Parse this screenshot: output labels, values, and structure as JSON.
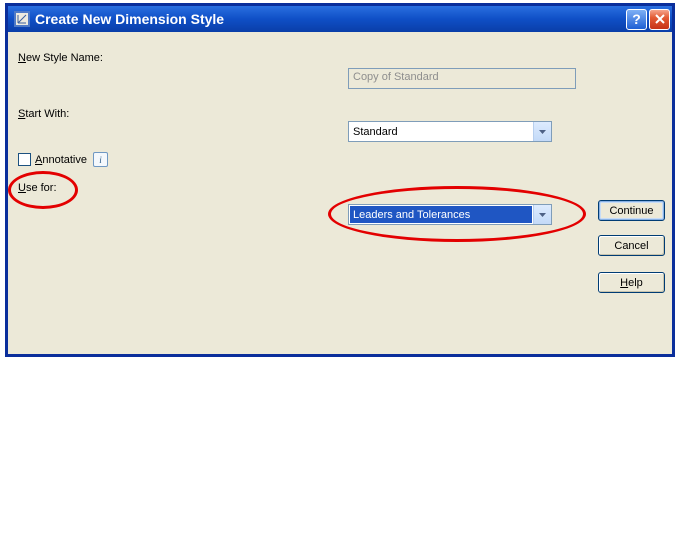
{
  "titlebar": {
    "title": "Create New Dimension Style"
  },
  "labels": {
    "new_style_name": "ew Style Name:",
    "new_style_name_m": "N",
    "start_with": "tart With:",
    "start_with_m": "S",
    "annotative": "nnotative",
    "annotative_m": "A",
    "use_for": "se for:",
    "use_for_m": "U"
  },
  "fields": {
    "new_style_name_value": "Copy of Standard",
    "start_with_value": "Standard",
    "use_for_value": "Leaders and Tolerances"
  },
  "buttons": {
    "continue": "Continue",
    "cancel": "Cancel",
    "help": "elp",
    "help_m": "H"
  }
}
